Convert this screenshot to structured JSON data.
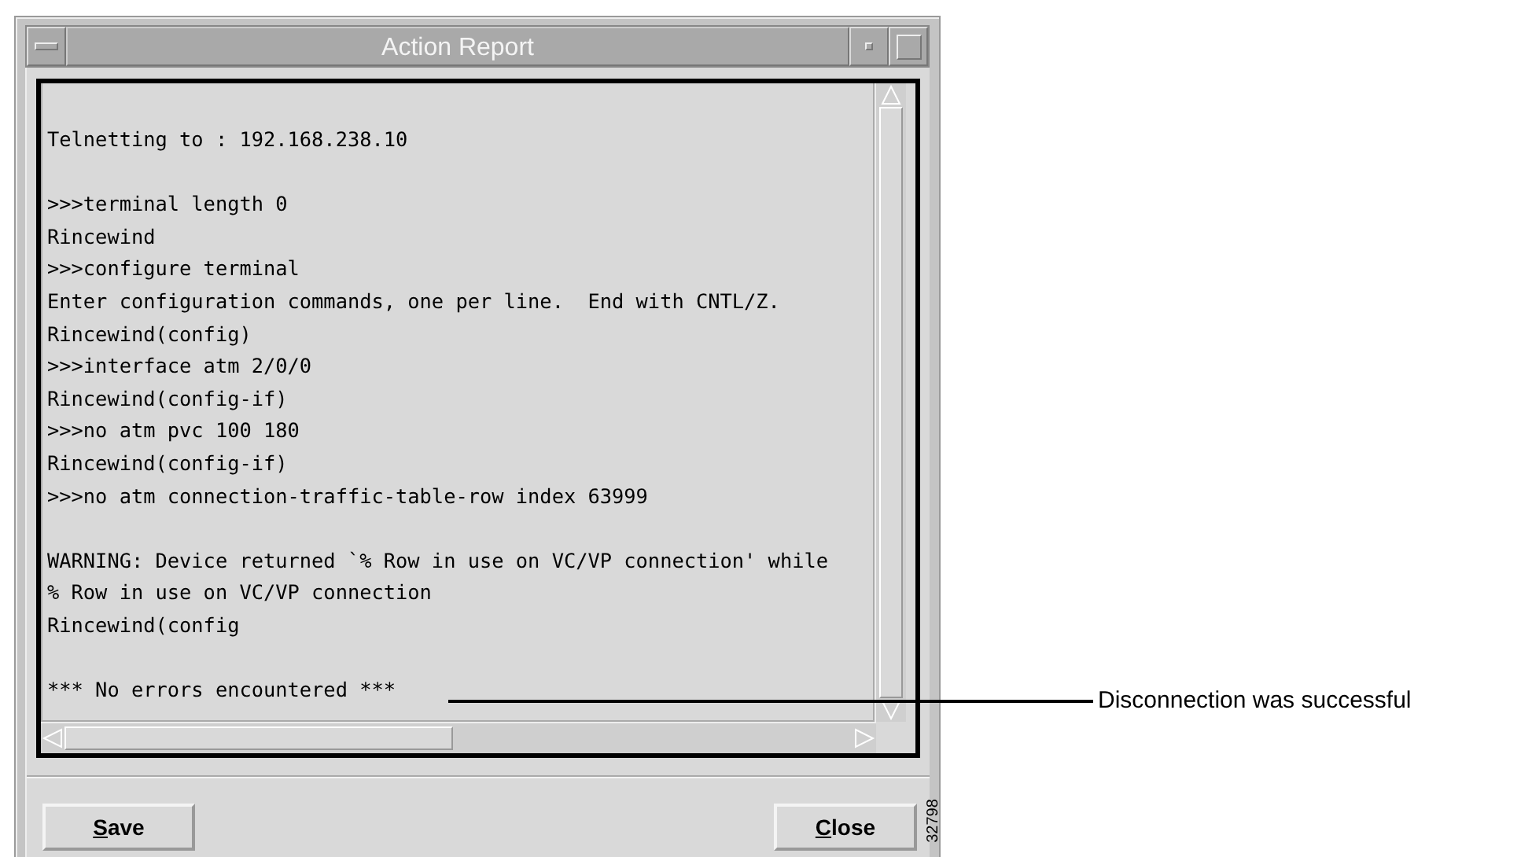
{
  "window": {
    "title": "Action Report"
  },
  "report": {
    "blocks": [
      [
        "Telnetting to : 192.168.238.10"
      ],
      [
        ">>>terminal length 0",
        "Rincewind",
        ">>>configure terminal",
        "Enter configuration commands, one per line.  End with CNTL/Z.",
        "Rincewind(config)",
        ">>>interface atm 2/0/0",
        "Rincewind(config-if)",
        ">>>no atm pvc 100 180",
        "Rincewind(config-if)",
        ">>>no atm connection-traffic-table-row index 63999"
      ],
      [
        "WARNING: Device returned `% Row in use on VC/VP connection' while",
        "% Row in use on VC/VP connection",
        "Rincewind(config"
      ],
      [
        "*** No errors encountered ***"
      ]
    ]
  },
  "buttons": [
    {
      "label": "Save",
      "mnemonic_underlined": true
    },
    {
      "label": "Close",
      "mnemonic_underlined": true
    }
  ],
  "callout": {
    "label": "Disconnection was successful"
  },
  "figure_number": "32798"
}
